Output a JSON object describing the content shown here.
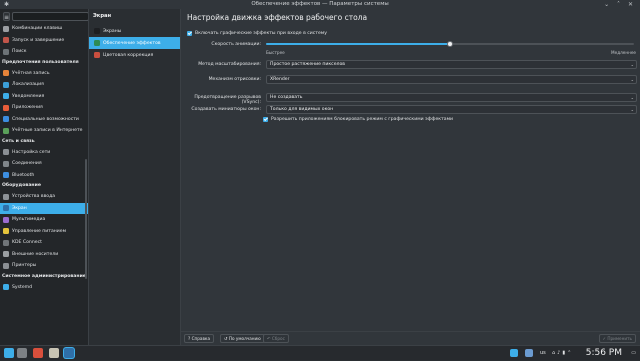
{
  "window": {
    "title": "Обеспечение эффектов — Параметры системы"
  },
  "sidebar": {
    "search_value": "",
    "groups": [
      {
        "label": "",
        "items": [
          {
            "label": "Комбинации клавиш",
            "color": "#9b9ea2",
            "active": false
          },
          {
            "label": "Запуск и завершение",
            "color": "#c1554a",
            "active": false
          },
          {
            "label": "Поиск",
            "color": "#6d7377",
            "active": false
          }
        ]
      },
      {
        "label": "Предпочтения пользователя",
        "items": [
          {
            "label": "Учётная запись",
            "color": "#e6843a",
            "active": false
          },
          {
            "label": "Локализация",
            "color": "#3c9fd8",
            "active": false
          },
          {
            "label": "Уведомления",
            "color": "#3daee9",
            "active": false
          },
          {
            "label": "Приложения",
            "color": "#e95d3a",
            "active": false
          },
          {
            "label": "Специальные возможности",
            "color": "#3c8de0",
            "active": false
          },
          {
            "label": "Учётные записи в Интернете",
            "color": "#5aa05a",
            "active": false
          }
        ]
      },
      {
        "label": "Сеть и связь",
        "items": [
          {
            "label": "Настройка сети",
            "color": "#8a8f94",
            "active": false
          },
          {
            "label": "Соединения",
            "color": "#7f858a",
            "active": false
          },
          {
            "label": "Bluetooth",
            "color": "#3d8ee0",
            "active": false
          }
        ]
      },
      {
        "label": "Оборудование",
        "items": [
          {
            "label": "Устройства ввода",
            "color": "#8c9196",
            "active": false
          },
          {
            "label": "Экран",
            "color": "#2f6fa8",
            "active": true
          },
          {
            "label": "Мультимедиа",
            "color": "#9a6bd0",
            "active": false
          },
          {
            "label": "Управление питанием",
            "color": "#e4c43c",
            "active": false
          },
          {
            "label": "KDE Connect",
            "color": "#707579",
            "active": false
          },
          {
            "label": "Внешние носители",
            "color": "#9a9ea2",
            "active": false
          },
          {
            "label": "Принтеры",
            "color": "#8a8f94",
            "active": false
          }
        ]
      },
      {
        "label": "Системное администрирование",
        "items": [
          {
            "label": "Systemd",
            "color": "#3daee9",
            "active": false
          }
        ]
      }
    ]
  },
  "subpanel": {
    "title": "Экран",
    "items": [
      {
        "label": "Экраны",
        "color": "#1d1f22",
        "active": false
      },
      {
        "label": "Обеспечение эффектов",
        "color": "#2e8b57",
        "active": true
      },
      {
        "label": "Цветовая коррекция",
        "color": "#c94f3f",
        "active": false
      }
    ]
  },
  "main": {
    "heading": "Настройка движка эффектов рабочего стола",
    "enable_effects_label": "Включать графические эффекты при входе в систему",
    "animation_speed_label": "Скорость анимации:",
    "animation_speed_value": 0.5,
    "speed_min_label": "Быстрее",
    "speed_max_label": "Медленнее",
    "scale_method_label": "Метод масштабирования:",
    "scale_method_value": "Простое растяжение пикселов",
    "render_backend_label": "Механизм отрисовки:",
    "render_backend_value": "XRender",
    "tearing_label": "Предотвращение разрывов (VSync):",
    "tearing_value": "Не создавать",
    "thumbnails_label": "Создавать миниатюры окон:",
    "thumbnails_value": "Только для видимых окон",
    "allow_block_label": "Разрешить приложениям блокировать режим с графическими эффектами"
  },
  "buttons": {
    "help": "Справка",
    "defaults": "По умолчанию",
    "reset": "Сброс",
    "apply": "Применить"
  },
  "taskbar": {
    "keyboard_layout": "us",
    "clock": "5:56 PM"
  },
  "colors": {
    "accent": "#3daee9",
    "window_bg": "#31363b",
    "sidebar_bg": "#232629"
  }
}
